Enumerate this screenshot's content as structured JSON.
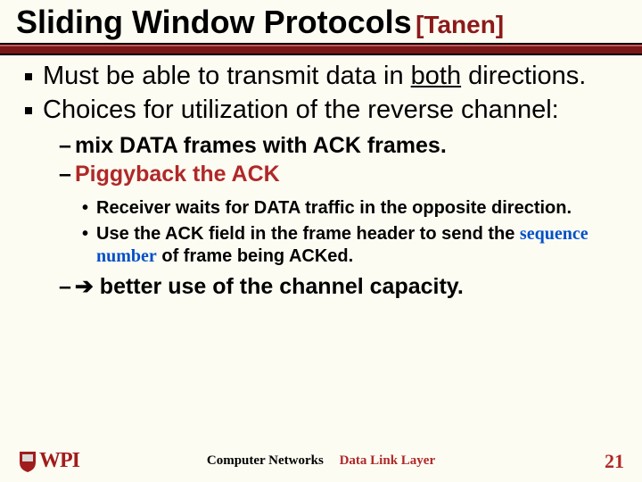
{
  "title": {
    "main": "Sliding Window Protocols",
    "ref": "[Tanen]"
  },
  "bullets": {
    "b1a": "Must be able to transmit data in ",
    "b1b": "both",
    "b1c": " directions.",
    "b2": "Choices for utilization of the reverse channel:"
  },
  "dash": {
    "d1": "mix DATA frames with ACK frames.",
    "d2": "Piggyback the ACK"
  },
  "sub": {
    "s1": "Receiver waits for DATA traffic in the opposite direction.",
    "s2a": "Use the ACK field in the frame header to send the ",
    "s2seq": "sequence number",
    "s2b": " of frame being ACKed."
  },
  "arrow": {
    "dash": "–",
    "sym": "➔",
    "text": " better use of the channel capacity."
  },
  "footer": {
    "logo": "WPI",
    "course": "Computer Networks",
    "topic": "Data Link Layer",
    "page": "21"
  }
}
